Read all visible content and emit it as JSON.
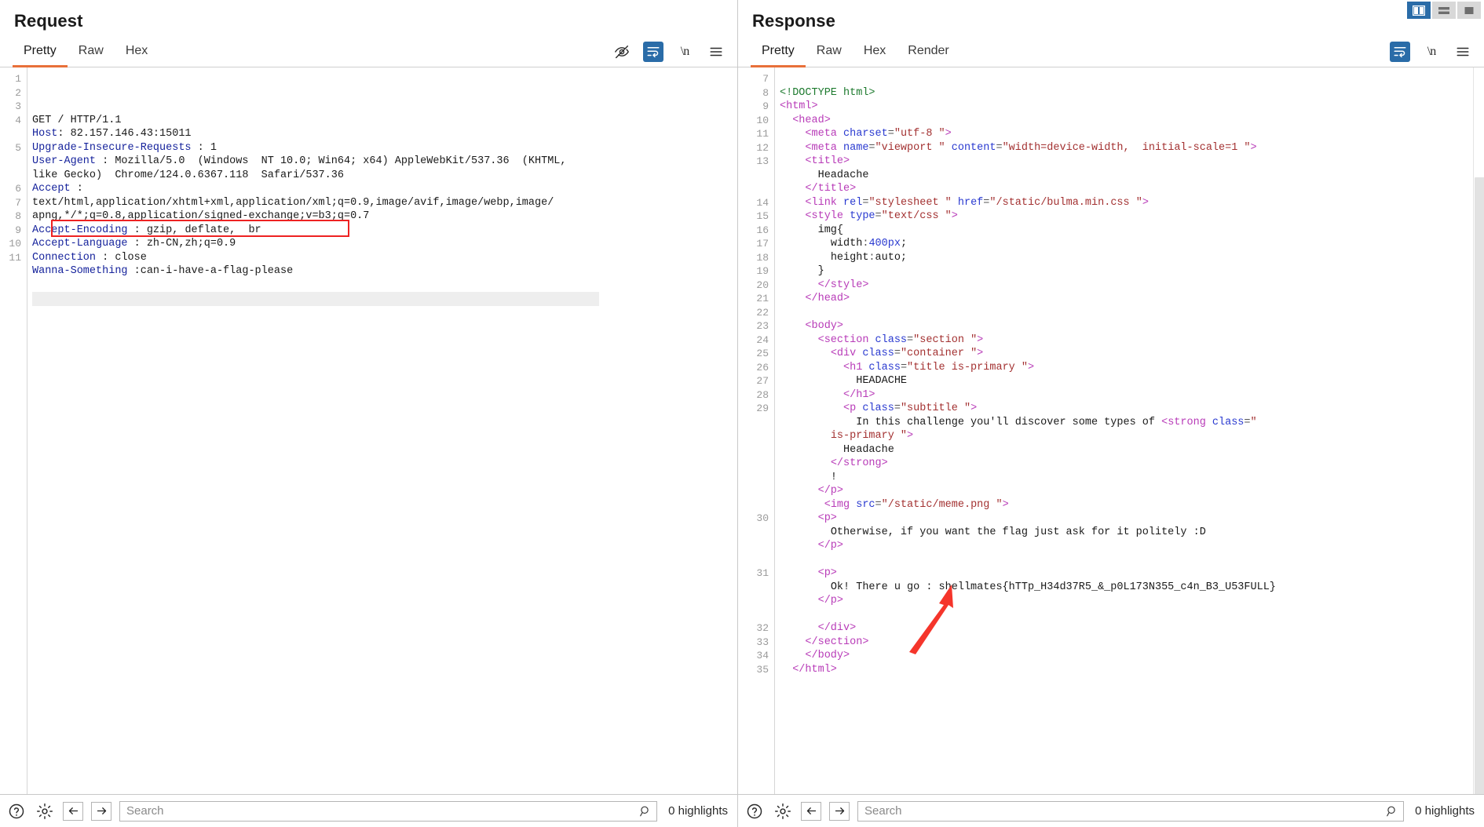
{
  "layout_toggles": [
    {
      "name": "side-by-side",
      "selected": true
    },
    {
      "name": "stacked",
      "selected": false
    },
    {
      "name": "single-pane",
      "selected": false
    }
  ],
  "request": {
    "title": "Request",
    "tabs": [
      "Pretty",
      "Raw",
      "Hex"
    ],
    "active_tab": "Pretty",
    "tools": [
      {
        "icon": "eye-off-icon",
        "selected": false
      },
      {
        "icon": "word-wrap-icon",
        "selected": true
      },
      {
        "icon": "newline-icon",
        "label": "\\n",
        "selected": false
      },
      {
        "icon": "menu-icon",
        "selected": false
      }
    ],
    "line_numbers": [
      "1",
      "2",
      "3",
      "4",
      "",
      "5",
      "",
      "",
      "6",
      "7",
      "8",
      "9",
      "10",
      "11"
    ],
    "lines": [
      {
        "num": "1",
        "type": "plain",
        "text": "GET / HTTP/1.1"
      },
      {
        "num": "2",
        "type": "header",
        "name": "Host",
        "sep": ": ",
        "value": "82.157.146.43:15011"
      },
      {
        "num": "3",
        "type": "header",
        "name": "Upgrade-Insecure-Requests",
        "sep": " : ",
        "value": "1"
      },
      {
        "num": "4",
        "type": "header",
        "name": "User-Agent",
        "sep": " : ",
        "value": "Mozilla/5.0  (Windows  NT 10.0; Win64; x64) AppleWebKit/537.36  (KHTML,"
      },
      {
        "num": "",
        "type": "cont",
        "text": "like Gecko)  Chrome/124.0.6367.118  Safari/537.36"
      },
      {
        "num": "5",
        "type": "header",
        "name": "Accept",
        "sep": " :",
        "value": ""
      },
      {
        "num": "",
        "type": "cont",
        "text": "text/html,application/xhtml+xml,application/xml;q=0.9,image/avif,image/webp,image/"
      },
      {
        "num": "",
        "type": "cont",
        "text": "apng,*/*;q=0.8,application/signed-exchange;v=b3;q=0.7"
      },
      {
        "num": "6",
        "type": "header",
        "name": "Accept-Encoding",
        "sep": " : ",
        "value": "gzip, deflate,  br"
      },
      {
        "num": "7",
        "type": "header",
        "name": "Accept-Language",
        "sep": " : ",
        "value": "zh-CN,zh;q=0.9"
      },
      {
        "num": "8",
        "type": "header",
        "name": "Connection",
        "sep": " : ",
        "value": "close"
      },
      {
        "num": "9",
        "type": "header",
        "name": "Wanna-Something",
        "sep": " :",
        "value": "can-i-have-a-flag-please",
        "highlighted": true
      },
      {
        "num": "10",
        "type": "plain",
        "text": ""
      },
      {
        "num": "11",
        "type": "blank",
        "text": ""
      }
    ],
    "bottom": {
      "help_icon": "help-circle-icon",
      "settings_icon": "gear-icon",
      "back_icon": "arrow-left-icon",
      "forward_icon": "arrow-right-icon",
      "search_placeholder": "Search",
      "search_value": "",
      "search_icon": "magnifier-icon",
      "highlights": "0 highlights"
    }
  },
  "response": {
    "title": "Response",
    "tabs": [
      "Pretty",
      "Raw",
      "Hex",
      "Render"
    ],
    "active_tab": "Pretty",
    "tools": [
      {
        "icon": "word-wrap-icon",
        "selected": true
      },
      {
        "icon": "newline-icon",
        "label": "\\n",
        "selected": false
      },
      {
        "icon": "menu-icon",
        "selected": false
      }
    ],
    "lines": [
      {
        "num": "7",
        "indent": 0,
        "tokens": []
      },
      {
        "num": "8",
        "indent": 0,
        "tokens": [
          {
            "c": "doct",
            "t": "<!DOCTYPE html>"
          }
        ]
      },
      {
        "num": "9",
        "indent": 0,
        "tokens": [
          {
            "c": "tag",
            "t": "<html>"
          }
        ]
      },
      {
        "num": "10",
        "indent": 1,
        "tokens": [
          {
            "c": "tag",
            "t": "<head>"
          }
        ]
      },
      {
        "num": "11",
        "indent": 2,
        "tokens": [
          {
            "c": "tag",
            "t": "<meta "
          },
          {
            "c": "attr",
            "t": "charset"
          },
          {
            "c": "punct",
            "t": "="
          },
          {
            "c": "val",
            "t": "\"utf-8 \""
          },
          {
            "c": "tag",
            "t": ">"
          }
        ]
      },
      {
        "num": "12",
        "indent": 2,
        "tokens": [
          {
            "c": "tag",
            "t": "<meta "
          },
          {
            "c": "attr",
            "t": "name"
          },
          {
            "c": "punct",
            "t": "="
          },
          {
            "c": "val",
            "t": "\"viewport \""
          },
          {
            "c": "attr",
            "t": " content"
          },
          {
            "c": "punct",
            "t": "="
          },
          {
            "c": "val",
            "t": "\"width=device-width,  initial-scale=1 \""
          },
          {
            "c": "tag",
            "t": ">"
          }
        ]
      },
      {
        "num": "13",
        "indent": 2,
        "tokens": [
          {
            "c": "tag",
            "t": "<title>"
          }
        ]
      },
      {
        "num": "",
        "indent": 3,
        "tokens": [
          {
            "c": "text",
            "t": "Headache"
          }
        ]
      },
      {
        "num": "",
        "indent": 2,
        "tokens": [
          {
            "c": "tag",
            "t": "</title>"
          }
        ]
      },
      {
        "num": "14",
        "indent": 2,
        "tokens": [
          {
            "c": "tag",
            "t": "<link "
          },
          {
            "c": "attr",
            "t": "rel"
          },
          {
            "c": "punct",
            "t": "="
          },
          {
            "c": "val",
            "t": "\"stylesheet \""
          },
          {
            "c": "attr",
            "t": " href"
          },
          {
            "c": "punct",
            "t": "="
          },
          {
            "c": "val",
            "t": "\"/static/bulma.min.css \""
          },
          {
            "c": "tag",
            "t": ">"
          }
        ]
      },
      {
        "num": "15",
        "indent": 2,
        "tokens": [
          {
            "c": "tag",
            "t": "<style "
          },
          {
            "c": "attr",
            "t": "type"
          },
          {
            "c": "punct",
            "t": "="
          },
          {
            "c": "val",
            "t": "\"text/css \""
          },
          {
            "c": "tag",
            "t": ">"
          }
        ]
      },
      {
        "num": "16",
        "indent": 3,
        "tokens": [
          {
            "c": "css",
            "t": "img{"
          }
        ]
      },
      {
        "num": "17",
        "indent": 4,
        "tokens": [
          {
            "c": "css",
            "t": "width"
          },
          {
            "c": "punct",
            "t": ":"
          },
          {
            "c": "num",
            "t": "400px"
          },
          {
            "c": "css",
            "t": ";"
          }
        ]
      },
      {
        "num": "18",
        "indent": 4,
        "tokens": [
          {
            "c": "css",
            "t": "height"
          },
          {
            "c": "punct",
            "t": ":"
          },
          {
            "c": "css",
            "t": "auto;"
          }
        ]
      },
      {
        "num": "19",
        "indent": 3,
        "tokens": [
          {
            "c": "css",
            "t": "}"
          }
        ]
      },
      {
        "num": "20",
        "indent": 3,
        "tokens": [
          {
            "c": "tag",
            "t": "</style>"
          }
        ]
      },
      {
        "num": "21",
        "indent": 2,
        "tokens": [
          {
            "c": "tag",
            "t": "</head>"
          }
        ]
      },
      {
        "num": "22",
        "indent": 0,
        "tokens": []
      },
      {
        "num": "23",
        "indent": 2,
        "tokens": [
          {
            "c": "tag",
            "t": "<body>"
          }
        ]
      },
      {
        "num": "24",
        "indent": 3,
        "tokens": [
          {
            "c": "tag",
            "t": "<section "
          },
          {
            "c": "attr",
            "t": "class"
          },
          {
            "c": "punct",
            "t": "="
          },
          {
            "c": "val",
            "t": "\"section \""
          },
          {
            "c": "tag",
            "t": ">"
          }
        ]
      },
      {
        "num": "25",
        "indent": 4,
        "tokens": [
          {
            "c": "tag",
            "t": "<div "
          },
          {
            "c": "attr",
            "t": "class"
          },
          {
            "c": "punct",
            "t": "="
          },
          {
            "c": "val",
            "t": "\"container \""
          },
          {
            "c": "tag",
            "t": ">"
          }
        ]
      },
      {
        "num": "26",
        "indent": 5,
        "tokens": [
          {
            "c": "tag",
            "t": "<h1 "
          },
          {
            "c": "attr",
            "t": "class"
          },
          {
            "c": "punct",
            "t": "="
          },
          {
            "c": "val",
            "t": "\"title is-primary \""
          },
          {
            "c": "tag",
            "t": ">"
          }
        ]
      },
      {
        "num": "27",
        "indent": 6,
        "tokens": [
          {
            "c": "text",
            "t": "HEADACHE"
          }
        ]
      },
      {
        "num": "28",
        "indent": 5,
        "tokens": [
          {
            "c": "tag",
            "t": "</h1>"
          }
        ]
      },
      {
        "num": "29",
        "indent": 5,
        "tokens": [
          {
            "c": "tag",
            "t": "<p "
          },
          {
            "c": "attr",
            "t": "class"
          },
          {
            "c": "punct",
            "t": "="
          },
          {
            "c": "val",
            "t": "\"subtitle \""
          },
          {
            "c": "tag",
            "t": ">"
          }
        ]
      },
      {
        "num": "",
        "indent": 6,
        "tokens": [
          {
            "c": "text",
            "t": "In this challenge you'll discover some types of "
          },
          {
            "c": "tag",
            "t": "<strong "
          },
          {
            "c": "attr",
            "t": "class"
          },
          {
            "c": "punct",
            "t": "="
          },
          {
            "c": "val",
            "t": "\""
          }
        ]
      },
      {
        "num": "",
        "indent": 4,
        "tokens": [
          {
            "c": "val",
            "t": "is-primary \""
          },
          {
            "c": "tag",
            "t": ">"
          }
        ]
      },
      {
        "num": "",
        "indent": 5,
        "tokens": [
          {
            "c": "text",
            "t": "Headache"
          }
        ]
      },
      {
        "num": "",
        "indent": 4,
        "tokens": [
          {
            "c": "tag",
            "t": "</strong>"
          }
        ]
      },
      {
        "num": "",
        "indent": 4,
        "tokens": [
          {
            "c": "text",
            "t": "!"
          }
        ]
      },
      {
        "num": "",
        "indent": 3,
        "tokens": [
          {
            "c": "tag",
            "t": "</p>"
          }
        ]
      },
      {
        "num": "",
        "indent": 3,
        "tokens": [
          {
            "c": "text",
            "t": " "
          },
          {
            "c": "tag",
            "t": "<img "
          },
          {
            "c": "attr",
            "t": "src"
          },
          {
            "c": "punct",
            "t": "="
          },
          {
            "c": "val",
            "t": "\"/static/meme.png \""
          },
          {
            "c": "tag",
            "t": ">"
          }
        ]
      },
      {
        "num": "30",
        "indent": 3,
        "tokens": [
          {
            "c": "tag",
            "t": "<p>"
          }
        ]
      },
      {
        "num": "",
        "indent": 4,
        "tokens": [
          {
            "c": "text",
            "t": "Otherwise, if you want the flag just ask for it politely :D"
          }
        ]
      },
      {
        "num": "",
        "indent": 3,
        "tokens": [
          {
            "c": "tag",
            "t": "</p>"
          }
        ]
      },
      {
        "num": "",
        "indent": 0,
        "tokens": []
      },
      {
        "num": "31",
        "indent": 3,
        "tokens": [
          {
            "c": "tag",
            "t": "<p>"
          }
        ]
      },
      {
        "num": "",
        "indent": 4,
        "tokens": [
          {
            "c": "text",
            "t": "Ok! There u go : shellmates{hTTp_H34d37R5_&_p0L173N355_c4n_B3_U53FULL}"
          }
        ]
      },
      {
        "num": "",
        "indent": 3,
        "tokens": [
          {
            "c": "tag",
            "t": "</p>"
          }
        ]
      },
      {
        "num": "",
        "indent": 0,
        "tokens": []
      },
      {
        "num": "32",
        "indent": 3,
        "tokens": [
          {
            "c": "tag",
            "t": "</div>"
          }
        ]
      },
      {
        "num": "33",
        "indent": 2,
        "tokens": [
          {
            "c": "tag",
            "t": "</section>"
          }
        ]
      },
      {
        "num": "34",
        "indent": 2,
        "tokens": [
          {
            "c": "tag",
            "t": "</body>"
          }
        ]
      },
      {
        "num": "35",
        "indent": 1,
        "tokens": [
          {
            "c": "tag",
            "t": "</html>"
          }
        ]
      }
    ],
    "bottom": {
      "help_icon": "help-circle-icon",
      "settings_icon": "gear-icon",
      "back_icon": "arrow-left-icon",
      "forward_icon": "arrow-right-icon",
      "search_placeholder": "Search",
      "search_value": "",
      "search_icon": "magnifier-icon",
      "highlights": "0 highlights"
    }
  },
  "annotation": {
    "arrow_color": "#f5352b",
    "arrow_points_to": "flag-text"
  },
  "colors": {
    "tab_accent": "#e8703a",
    "tool_selected_bg": "#2a6ca8",
    "highlight_box": "#ee2222",
    "header_name": "#16239c",
    "tag": "#b83bb8",
    "attr": "#2a3ad0",
    "value": "#a33131",
    "doctype": "#1d7a2e"
  }
}
